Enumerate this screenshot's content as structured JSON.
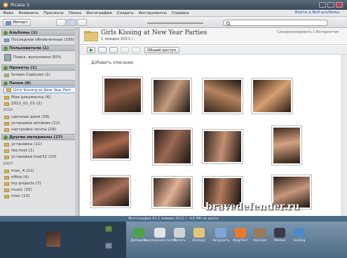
{
  "window": {
    "title": "Picasa 3"
  },
  "menu": {
    "items": [
      "Файл",
      "Изменить",
      "Просмотр",
      "Папка",
      "Фотография",
      "Создать",
      "Инструменты",
      "Справка"
    ],
    "signin": "Войти в Веб-альбомы"
  },
  "toolbar": {
    "import_label": "Импорт"
  },
  "sidebar": {
    "albums_header": "Альбомы (1)",
    "albums_item": "Последние обновленные (195)",
    "people_header": "Пользователи (1)",
    "people_item": "Поиск, выполнено 50%",
    "projects_header": "Проекты (1)",
    "projects_item": "Screen Captures (1)",
    "folders_header": "Папки (8)",
    "folder_selected": "Girls Kissing at New Year Part...",
    "folder_items": [
      "Мои документы (6)",
      "2011_01_01 (2)"
    ],
    "year_2010": "2010",
    "year_2010_items": [
      "сдочные доки (29)",
      "установка windows (12)",
      "настройка почты (29)"
    ],
    "other_header": "Другие материалы (27)",
    "other_items": [
      "установка (11)",
      "faq host (1)",
      "установка host32 (10)"
    ],
    "year_2007": "2007",
    "year_2007_items": [
      "misc_4 (22)",
      "office (4)",
      "my projects (7)",
      "music (15)",
      "misc (13)"
    ]
  },
  "main": {
    "folder_title": "Girls Kissing at New Year Parties",
    "folder_date": "1 января 2011 г.",
    "sync_info": "Синхронизировать с Интернетом",
    "share_label": "Общий доступ",
    "add_description": "Добавить описание"
  },
  "statusbar": {
    "text": "Фотография 01     1 января 2011 г.     4,8 Мб на диске"
  },
  "tray": {
    "items": [
      "Добавить",
      "Электронная почта",
      "Печать",
      "Экспорт",
      "Загрузить",
      "BlogThis!",
      "Коллаж",
      "Фильм",
      "Geotag"
    ]
  },
  "watermark": "bravedefender.ru"
}
